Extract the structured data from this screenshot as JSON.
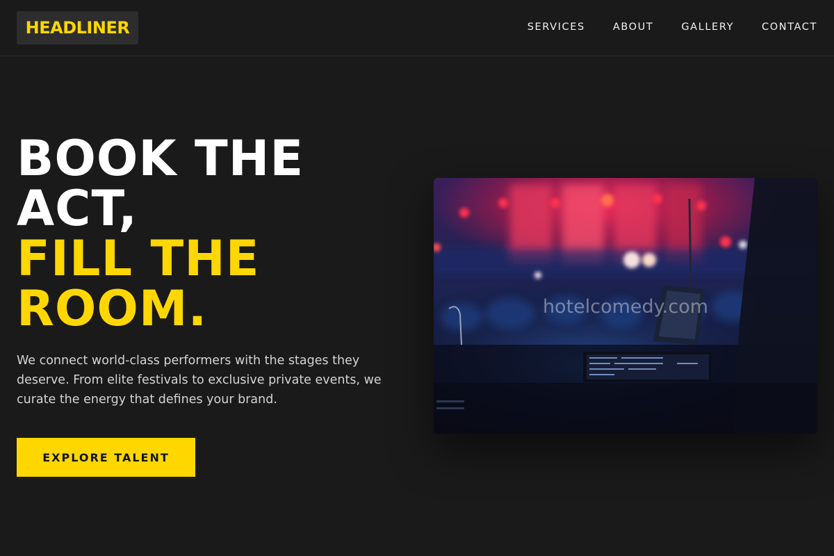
{
  "brand": {
    "logo_text": "HEADLINER",
    "accent_color": "#ffd700"
  },
  "nav": {
    "items": [
      {
        "label": "SERVICES"
      },
      {
        "label": "ABOUT"
      },
      {
        "label": "GALLERY"
      },
      {
        "label": "CONTACT"
      }
    ]
  },
  "hero": {
    "headline_white_1": "BOOK THE",
    "headline_white_2": "ACT,",
    "headline_yellow_1": "FILL THE",
    "headline_yellow_2": "ROOM.",
    "description": "We connect world-class performers with the stages they deserve. From elite festivals to exclusive private events, we curate the energy that defines your brand.",
    "cta_label": "EXPLORE TALENT",
    "image": {
      "subject": "concert-stage-with-crowd-and-mixing-console",
      "watermark": "hotelcomedy.com"
    }
  },
  "colors": {
    "background": "#1a1a1a",
    "text": "#ffffff",
    "muted_text": "#d4d4d4"
  }
}
